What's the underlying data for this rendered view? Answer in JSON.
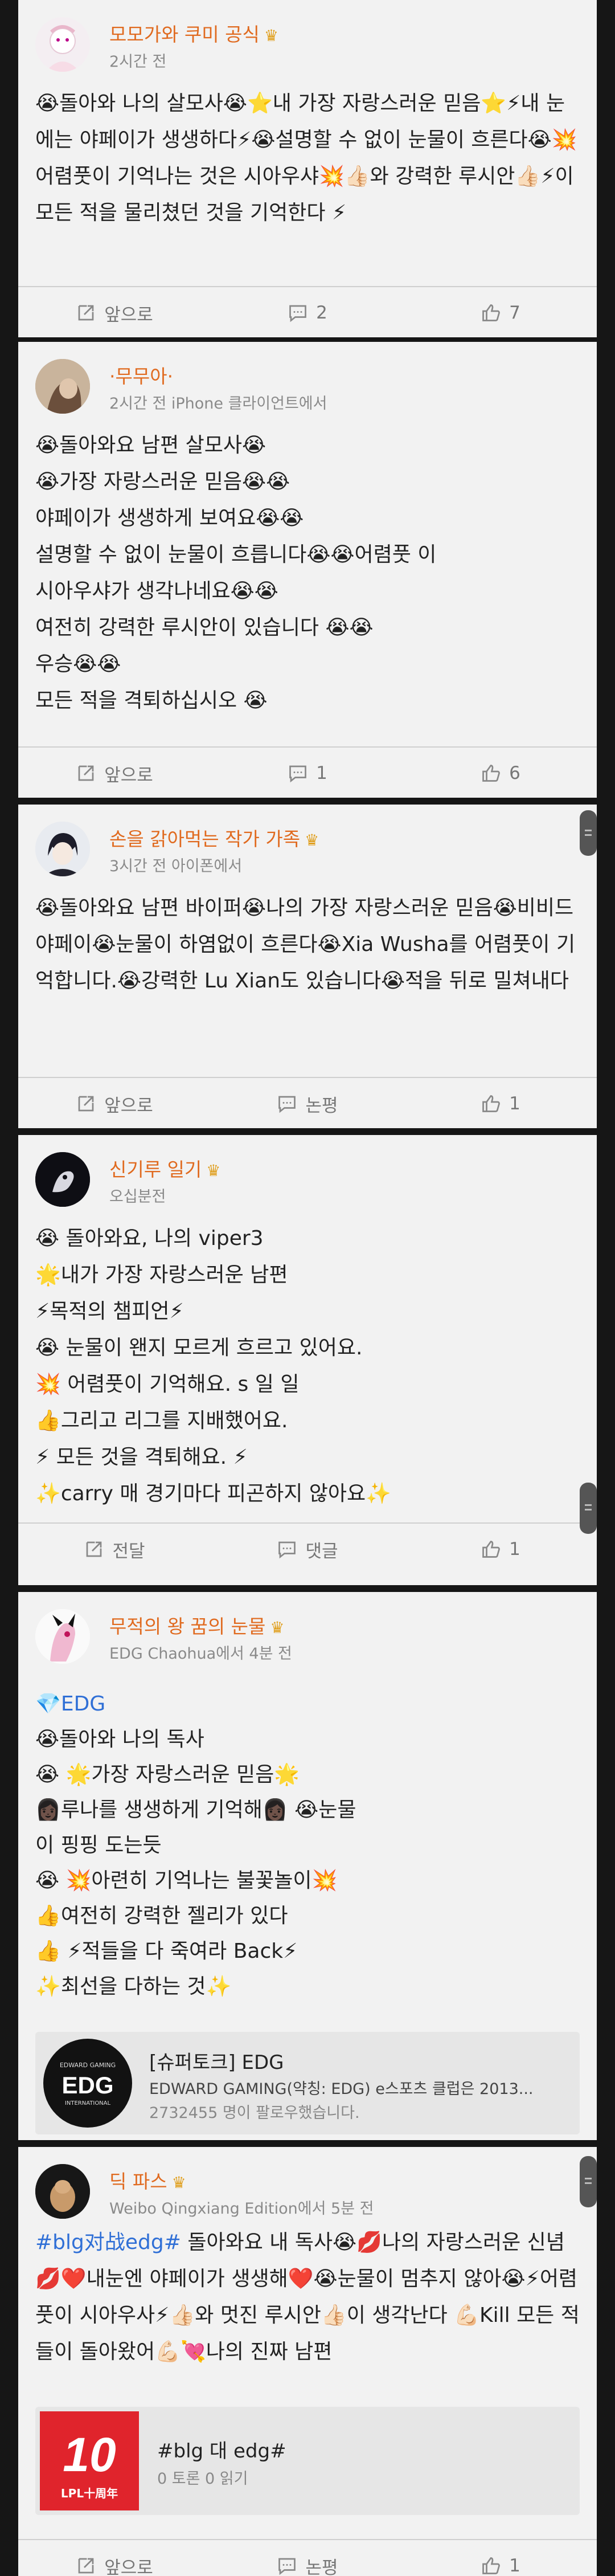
{
  "posts": [
    {
      "user": "모모가와 쿠미 공식",
      "meta": "2시간 전",
      "lines": [
        "😭돌아와 나의 살모사😭⭐내 가장 자랑스러운 믿음⭐⚡내 눈에는 야페이가 생생하다⚡😭설명할 수 없이 눈물이 흐른다😭💥어렴풋이 기억나는 것은 시아우샤💥👍🏻와 강력한 루시안👍🏻⚡이 모든 적을 물리쳤던 것을 기억한다 ⚡"
      ],
      "actions": {
        "share": "앞으로",
        "comment": "2",
        "like": "7"
      }
    },
    {
      "user": "·무무아·",
      "meta": "2시간 전 iPhone 클라이언트에서",
      "lines": [
        "😭돌아와요 남편 살모사😭",
        "😭가장 자랑스러운 믿음😭😭",
        "야페이가 생생하게 보여요😭😭",
        "설명할 수 없이 눈물이 흐릅니다😭😭어렴풋 이",
        "시아우샤가 생각나네요😭😭",
        "여전히 강력한 루시안이 있습니다 😭😭",
        "우승😭😭",
        "모든 적을 격퇴하십시오 😭"
      ],
      "actions": {
        "share": "앞으로",
        "comment": "1",
        "like": "6"
      }
    },
    {
      "user": "손을 갉아먹는 작가 가족",
      "meta": "3시간 전 아이폰에서",
      "lines": [
        "😭돌아와요 남편 바이퍼😭나의 가장 자랑스러운 믿음😭비비드 야페이😭눈물이 하염없이 흐른다😭Xia Wusha를 어렴풋이 기억합니다.😭강력한 Lu Xian도 있습니다😭적을 뒤로 밀쳐내다"
      ],
      "actions": {
        "share": "앞으로",
        "comment": "논평",
        "like": "1"
      }
    },
    {
      "user": "신기루 일기",
      "meta": "오십분전",
      "lines": [
        "😭 돌아와요, 나의 viper3",
        "🌟내가 가장 자랑스러운 남편",
        "⚡목적의 챔피언⚡",
        "😭 눈물이 왠지 모르게 흐르고 있어요.",
        "💥 어렴풋이 기억해요. s 일 일",
        "👍그리고 리그를 지배했어요.",
        "⚡ 모든 것을 격퇴해요. ⚡",
        "✨carry 매 경기마다 피곤하지 않아요✨"
      ],
      "actions": {
        "share": "전달",
        "comment": "댓글",
        "like": "1"
      }
    },
    {
      "user": "무적의 왕 꿈의 눈물",
      "meta": "EDG Chaohua에서 4분 전",
      "lines": [
        "💎EDG",
        "😭돌아와 나의 독사",
        "😭 🌟가장 자랑스러운 믿음🌟",
        "👩🏿루나를 생생하게 기억해👩🏿 😭눈물",
        "이 핑핑 도는듯",
        "😭 💥아련히 기억나는 불꽃놀이💥",
        "👍여전히 강력한 젤리가 있다",
        "👍 ⚡적들을 다 죽여라 Back⚡",
        "✨최선을 다하는 것✨"
      ],
      "card": {
        "logo_text": "EDG",
        "logo_small_top": "EDWARD GAMING",
        "logo_small_bottom": "INTERNATIONAL",
        "title": "[슈퍼토크] EDG",
        "desc": "EDWARD GAMING(약칭: EDG) e스포츠 클럽은 2013...",
        "followers": "2732455 명이 팔로우했습니다."
      }
    },
    {
      "user": "딕 파스",
      "meta": "Weibo Qingxiang Edition에서 5분 전",
      "hashtag": "#blg对战edg#",
      "lines": [
        " 돌아와요 내 독사😭💋나의 자랑스러운 신념💋❤️내눈엔 야페이가 생생해❤️😭눈물이 멈추지 않아😭⚡어렴풋이 시아우사⚡👍🏻와 멋진 루시안👍🏻이 생각난다 💪🏻Kill 모든 적들이 돌아왔어💪🏻💘나의 진짜 남편"
      ],
      "card": {
        "logo_text": "10",
        "logo_small": "LPL十周年",
        "title": "#blg 대 edg#",
        "desc": "0 토론 0 읽기"
      },
      "actions": {
        "share": "앞으로",
        "comment": "논평",
        "like": "1"
      }
    }
  ]
}
